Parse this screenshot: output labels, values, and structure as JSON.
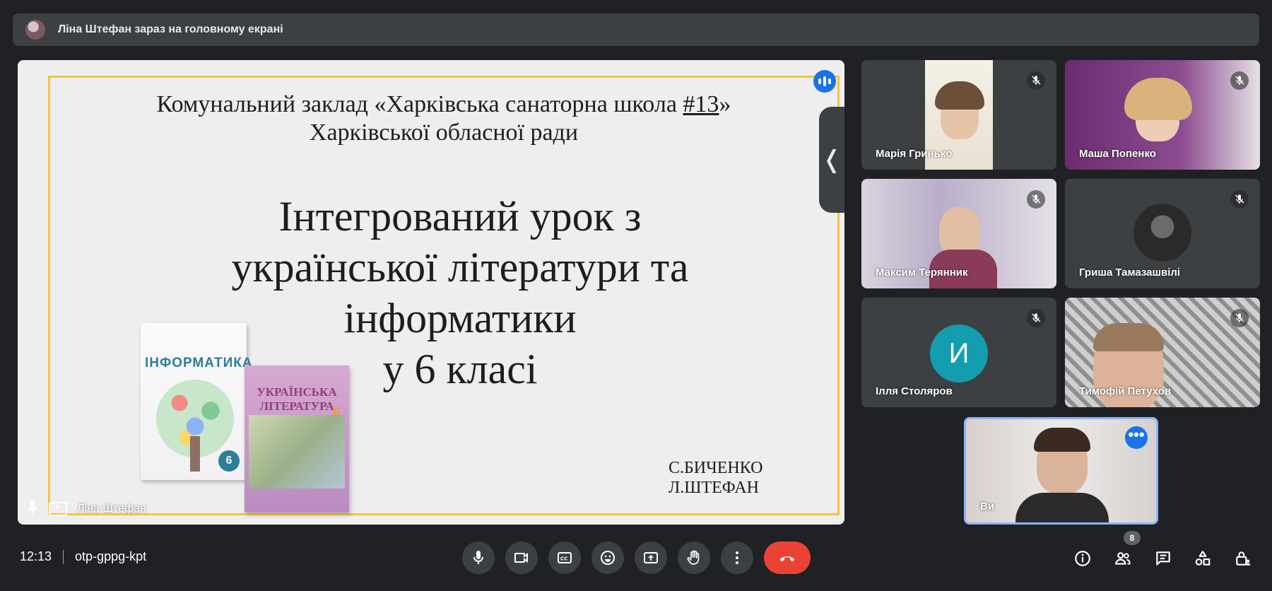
{
  "banner": {
    "text": "Ліна Штефан зараз на головному екрані"
  },
  "slide": {
    "header_line1_a": "Комунальний заклад «Харківська санаторна школа ",
    "header_line1_num": "#13",
    "header_line1_b": "»",
    "header_line2": "Харківської обласної ради",
    "title_lines": [
      "Інтегрований урок з",
      "української літератури та",
      "інформатики",
      "у 6 класі"
    ],
    "authors": [
      "С.БИЧЕНКО",
      "Л.ШТЕФАН"
    ],
    "book1_title": "ІНФОРМАТИКА",
    "book1_grade": "6",
    "book2_title_line1": "УКРАЇНСЬКА",
    "book2_title_line2": "ЛІТЕРАТУРА",
    "book2_grade": "6"
  },
  "stage": {
    "presenter_name": "Ліна Штефан",
    "collapse_glyph": "❬"
  },
  "participants": [
    {
      "name": "Марія Гринько",
      "muted": true
    },
    {
      "name": "Маша Попенко",
      "muted": true
    },
    {
      "name": "Максим Терянник",
      "muted": true
    },
    {
      "name": "Гриша Тамазашвілі",
      "muted": true
    },
    {
      "name": "Ілля Столяров",
      "muted": true,
      "avatar_letter": "И"
    },
    {
      "name": "Тимофій Петухов",
      "muted": true
    }
  ],
  "self_tile": {
    "name": "Ви",
    "more_glyph": "•••"
  },
  "meeting": {
    "time": "12:13",
    "code": "otp-gppg-kpt",
    "participant_count": "8"
  },
  "colors": {
    "background": "#202124",
    "surface": "#3c4043",
    "accent": "#1a73e8",
    "end_call": "#ea4335",
    "slide_border": "#f3c440",
    "avatar_teal": "#129eaf"
  }
}
